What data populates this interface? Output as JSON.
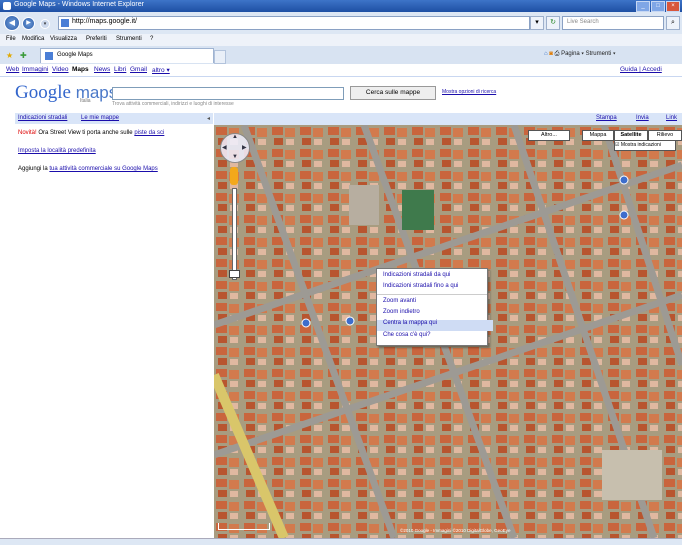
{
  "window": {
    "title": "Google Maps - Windows Internet Explorer"
  },
  "browser": {
    "url": "http://maps.google.it/",
    "search_placeholder": "Live Search",
    "menu": [
      "File",
      "Modifica",
      "Visualizza",
      "Preferiti",
      "Strumenti",
      "?"
    ],
    "tab_label": "Google Maps",
    "command_bar": "Pagina ▾  Strumenti ▾"
  },
  "google_bar": {
    "links": [
      "Web",
      "Immagini",
      "Video",
      "Maps",
      "News",
      "Libri",
      "Gmail",
      "altro ▾"
    ],
    "right_links": "Guida | Accedi"
  },
  "header": {
    "logo_word": "Google",
    "logo_maps": "maps",
    "logo_sub": "Italia",
    "search_value": "",
    "hint": "Trova attività commerciali, indirizzi e luoghi di interesse",
    "search_button": "Cerca sulle mappe",
    "search_options": "Mostra opzioni di ricerca"
  },
  "sidebar": {
    "tab_directions": "Indicazioni stradali",
    "tab_mymaps": "Le mie mappe",
    "novita_label": "Novità!",
    "novita_text": "Ora Street View ti porta anche sulle",
    "novita_link": "piste da sci",
    "default_location": "Imposta la località predefinita",
    "add_business_prefix": "Aggiungi la",
    "add_business_link": "tua attività commerciale su Google Maps"
  },
  "map_header": {
    "print": "Stampa",
    "send": "Invia",
    "link": "Link"
  },
  "map_types": [
    "Altro...",
    "Mappa",
    "Satellite",
    "Rilievo"
  ],
  "map_type_selected": "Satellite",
  "map_labels_checkbox": "Mostra indicazioni",
  "context_menu": {
    "items": [
      "Indicazioni stradali da qui",
      "Indicazioni stradali fino a qui",
      "Zoom avanti",
      "Zoom indietro",
      "Centra la mappa qui",
      "Che cosa c'è qui?"
    ],
    "highlighted": "Centra la mappa qui"
  },
  "map_footer": {
    "copyright": "©2010 Google - Immagini ©2010 DigitalGlobe, GeoEye"
  }
}
